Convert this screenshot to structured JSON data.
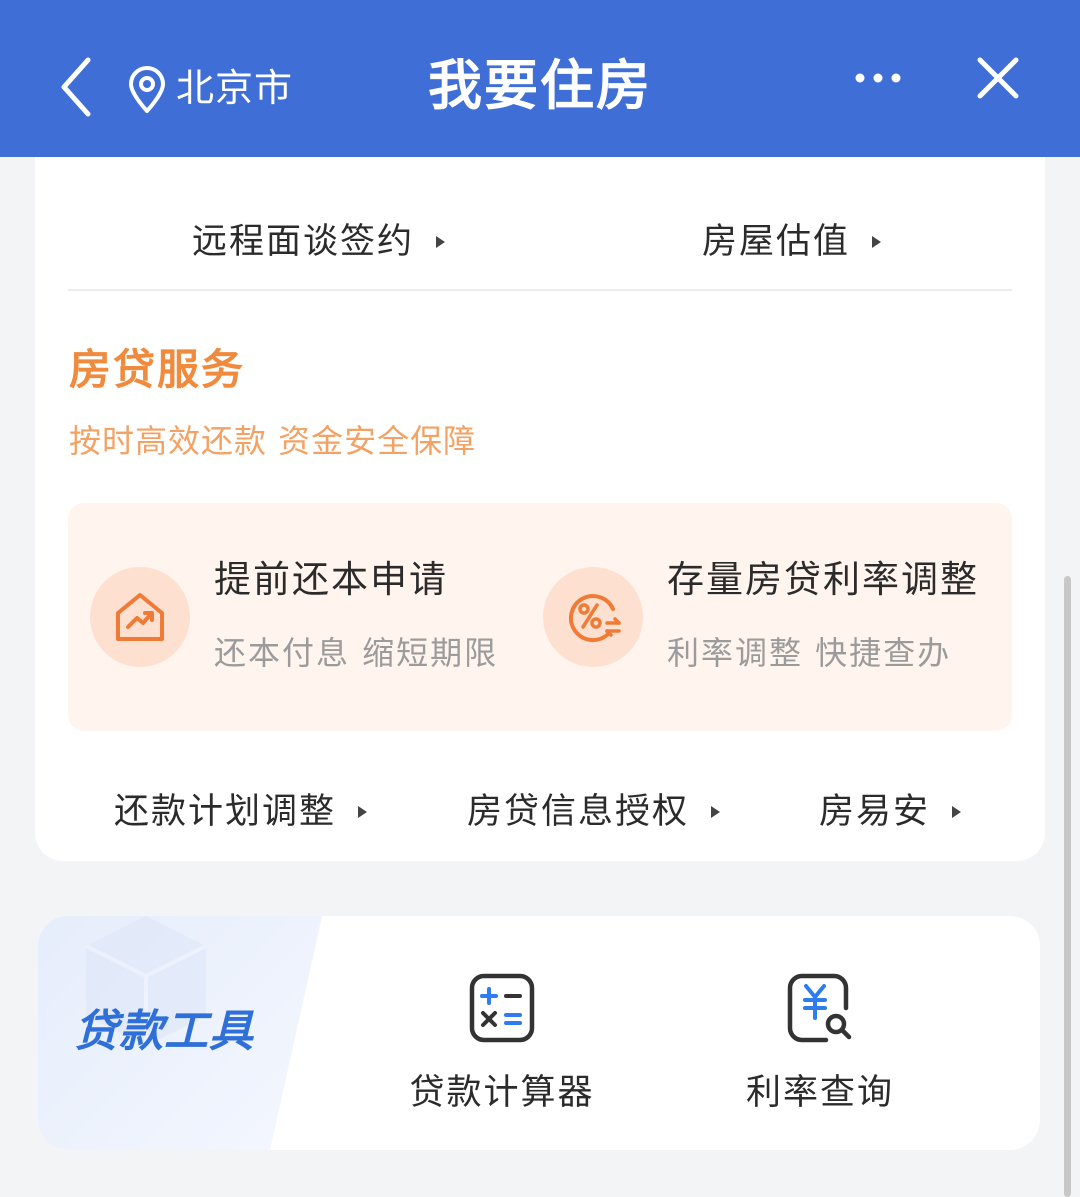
{
  "header": {
    "back_icon": "chevron-left-icon",
    "location_icon": "location-pin-icon",
    "city": "北京市",
    "title": "我要住房",
    "more_icon": "more-dots-icon",
    "close_icon": "close-icon",
    "color": "#3f6fd6"
  },
  "top_links": [
    {
      "label": "远程面谈签约"
    },
    {
      "label": "房屋估值"
    }
  ],
  "mortgage": {
    "title": "房贷服务",
    "subtitle": "按时高效还款 资金安全保障",
    "accent": "#f08a3c",
    "promos": [
      {
        "title": "提前还本申请",
        "subtitle": "还本付息 缩短期限",
        "icon": "house-trend-icon"
      },
      {
        "title": "存量房贷利率调整",
        "subtitle": "利率调整 快捷查办",
        "icon": "percent-exchange-icon"
      }
    ],
    "links": [
      {
        "label": "还款计划调整"
      },
      {
        "label": "房贷信息授权"
      },
      {
        "label": "房易安"
      }
    ]
  },
  "tools": {
    "title": "贷款工具",
    "accent": "#2f6fd8",
    "items": [
      {
        "label": "贷款计算器",
        "icon": "calculator-icon"
      },
      {
        "label": "利率查询",
        "icon": "yuan-search-icon"
      }
    ]
  }
}
